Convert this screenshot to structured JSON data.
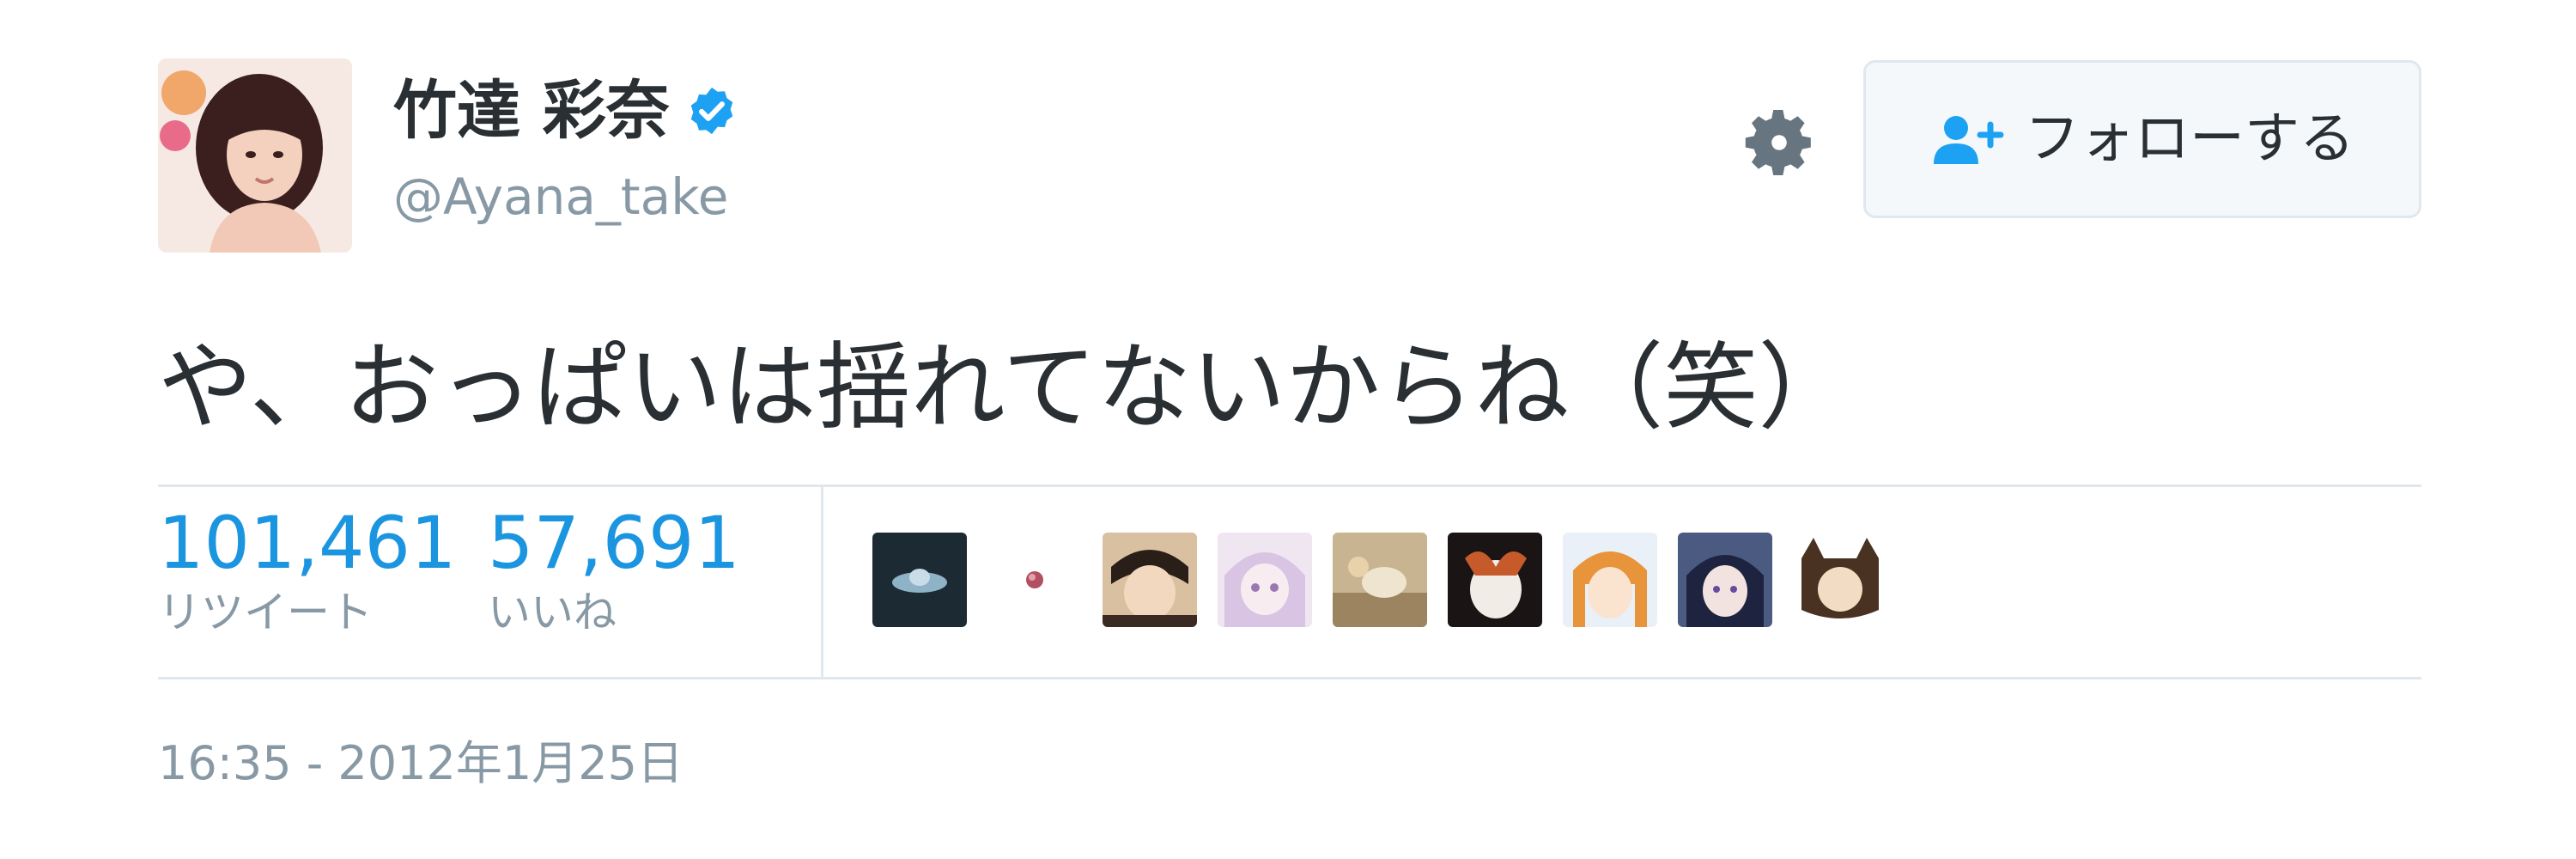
{
  "user": {
    "display_name": "竹達 彩奈",
    "handle": "@Ayana_take",
    "avatar_icon": "profile-photo",
    "verified_icon": "verified-badge-icon"
  },
  "actions": {
    "settings_icon": "gear-icon",
    "follow_icon": "add-user-icon",
    "follow_label": "フォローする"
  },
  "tweet": {
    "text": "や、おっぱいは揺れてないからね（笑）",
    "timestamp": "16:35 - 2012年1月25日"
  },
  "stats": {
    "retweets": {
      "count": "101,461",
      "label": "リツイート"
    },
    "likes": {
      "count": "57,691",
      "label": "いいね"
    }
  },
  "likers": [
    "liker-avatar",
    "liker-avatar",
    "liker-avatar",
    "liker-avatar",
    "liker-avatar",
    "liker-avatar",
    "liker-avatar",
    "liker-avatar",
    "liker-avatar"
  ],
  "colors": {
    "text": "#292f33",
    "secondary": "#8899a6",
    "accent": "#1b95e0",
    "verified": "#1da1f2",
    "border": "#e1e8ed",
    "button_bg": "#f5f8fa"
  }
}
